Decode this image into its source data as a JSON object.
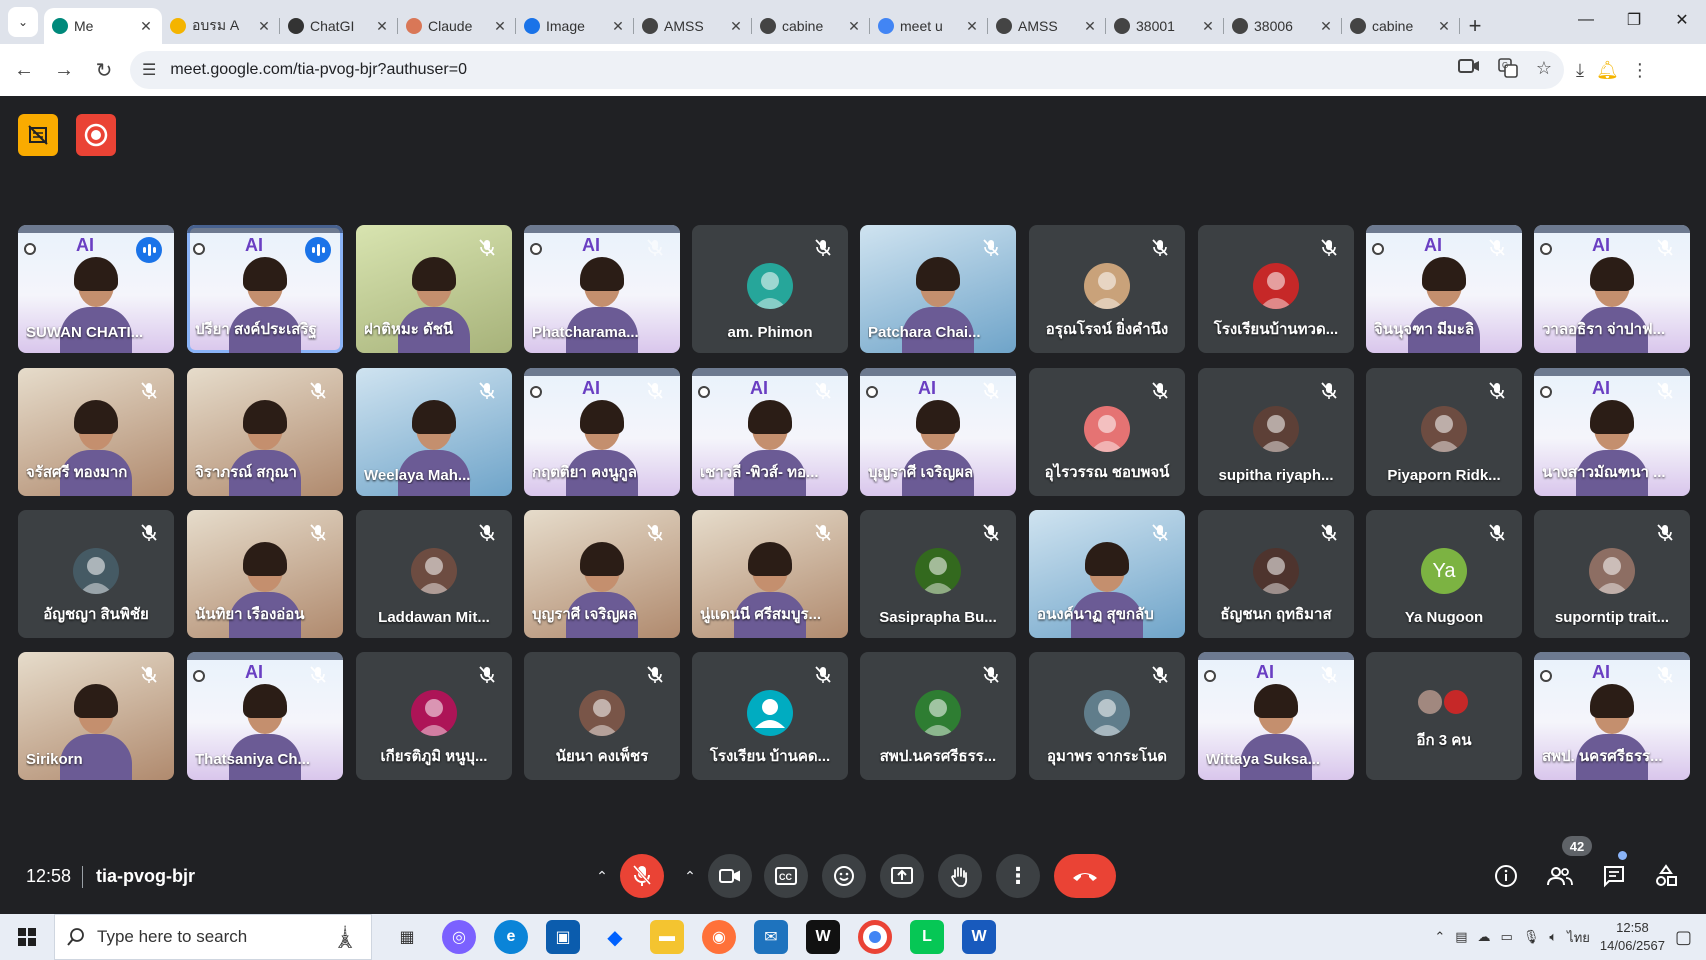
{
  "browser": {
    "tabs": [
      {
        "label": "Me",
        "icon": "meet-icon",
        "color": "#00897b",
        "active": true
      },
      {
        "label": "อบรม A",
        "icon": "car-icon",
        "color": "#f4b400"
      },
      {
        "label": "ChatGI",
        "icon": "openai-icon",
        "color": "#333333"
      },
      {
        "label": "Claude",
        "icon": "claude-icon",
        "color": "#d97757"
      },
      {
        "label": "Image",
        "icon": "search-icon",
        "color": "#1a73e8"
      },
      {
        "label": "AMSS",
        "icon": "globe-icon",
        "color": "#444444"
      },
      {
        "label": "cabine",
        "icon": "globe-icon",
        "color": "#444444"
      },
      {
        "label": "meet u",
        "icon": "google-icon",
        "color": "#4285f4"
      },
      {
        "label": "AMSS",
        "icon": "globe-icon",
        "color": "#444444"
      },
      {
        "label": "38001",
        "icon": "globe-icon",
        "color": "#444444"
      },
      {
        "label": "38006",
        "icon": "globe-icon",
        "color": "#444444"
      },
      {
        "label": "cabine",
        "icon": "globe-icon",
        "color": "#444444"
      }
    ],
    "url": "meet.google.com/tia-pvog-bjr?authuser=0"
  },
  "meet": {
    "rows": [
      [
        {
          "name": "SUWAN CHATI...",
          "type": "slide",
          "speaking": true
        },
        {
          "name": "ปรียา สงค์ประเสริฐ",
          "type": "slide",
          "speaking": true,
          "active": true
        },
        {
          "name": "ฝาติหมะ ดัชนี",
          "type": "green"
        },
        {
          "name": "Phatcharama...",
          "type": "slide",
          "muted_faint": true
        },
        {
          "name": "am. Phimon",
          "type": "avatar",
          "avatar_color": "#26a69a"
        },
        {
          "name": "Patchara Chai...",
          "type": "blue"
        },
        {
          "name": "อรุณโรจน์ ยิ่งคำนึง",
          "type": "avatar",
          "avatar_color": "#c9a27a"
        },
        {
          "name": "โรงเรียนบ้านทวด...",
          "type": "avatar",
          "avatar_color": "#c62828"
        },
        {
          "name": "จินนุจฑา มีมะลิ",
          "type": "slide"
        },
        {
          "name": "วาลอธิรา จ่าปาฟ...",
          "type": "slide"
        }
      ],
      [
        {
          "name": "จรัสศรี ทองมาก",
          "type": "warm"
        },
        {
          "name": "จิราภรณ์ สกุณา",
          "type": "warm"
        },
        {
          "name": "Weelaya Mah...",
          "type": "blue"
        },
        {
          "name": "กฤตติยา คงนูกูล",
          "type": "slide"
        },
        {
          "name": "เชาวลี -พิวส์- ทอ...",
          "type": "slide"
        },
        {
          "name": "บุญราศี เจริญผล",
          "type": "slide"
        },
        {
          "name": "อุไรวรรณ ชอบพจน์",
          "type": "avatar",
          "avatar_color": "#e57373"
        },
        {
          "name": "supitha riyaph...",
          "type": "avatar",
          "avatar_color": "#5d4037"
        },
        {
          "name": "Piyaporn Ridk...",
          "type": "avatar",
          "avatar_color": "#6d4c41"
        },
        {
          "name": "นางสาวมัณฑนา ...",
          "type": "slide"
        }
      ],
      [
        {
          "name": "อัญชญา สินพิชัย",
          "type": "avatar",
          "avatar_color": "#455a64"
        },
        {
          "name": "นันทิยา เรืองอ่อน",
          "type": "warm"
        },
        {
          "name": "Laddawan Mit...",
          "type": "avatar",
          "avatar_color": "#6d4c41"
        },
        {
          "name": "บุญราศี เจริญผล",
          "type": "warm"
        },
        {
          "name": "นู่แดนนี ศรีสมบูร...",
          "type": "warm"
        },
        {
          "name": "Sasiprapha Bu...",
          "type": "avatar",
          "avatar_color": "#33691e"
        },
        {
          "name": "อนงค์นาฏ สุขกลับ",
          "type": "blue"
        },
        {
          "name": "ธัญชนก ฤทธิมาส",
          "type": "avatar",
          "avatar_color": "#4e342e"
        },
        {
          "name": "Ya Nugoon",
          "type": "letter",
          "letter": "Ya",
          "avatar_color": "#7cb342"
        },
        {
          "name": "suporntip trait...",
          "type": "avatar",
          "avatar_color": "#8d6e63"
        }
      ],
      [
        {
          "name": "Sirikorn",
          "type": "warm"
        },
        {
          "name": "Thatsaniya Ch...",
          "type": "slide"
        },
        {
          "name": "เกียรติภูมิ หนูบุ...",
          "type": "avatar",
          "avatar_color": "#ad1457"
        },
        {
          "name": "นัยนา คงเพ็ชร",
          "type": "avatar",
          "avatar_color": "#795548"
        },
        {
          "name": "โรงเรียน บ้านคด...",
          "type": "person_icon",
          "avatar_color": "#00acc1"
        },
        {
          "name": "สพป.นครศรีธรร...",
          "type": "avatar",
          "avatar_color": "#2e7d32"
        },
        {
          "name": "อุมาพร จากระโนด",
          "type": "avatar",
          "avatar_color": "#607d8b"
        },
        {
          "name": "Wittaya Suksa...",
          "type": "slide"
        },
        {
          "name": "อีก 3 คน",
          "type": "more"
        },
        {
          "name": "สพป. นครศรีธรร...",
          "type": "slide"
        }
      ]
    ],
    "time": "12:58",
    "meeting_code": "tia-pvog-bjr",
    "participants_count": "42"
  },
  "taskbar": {
    "search_placeholder": "Type here to search",
    "lang": "ไทย",
    "time": "12:58",
    "date": "14/06/2567"
  }
}
